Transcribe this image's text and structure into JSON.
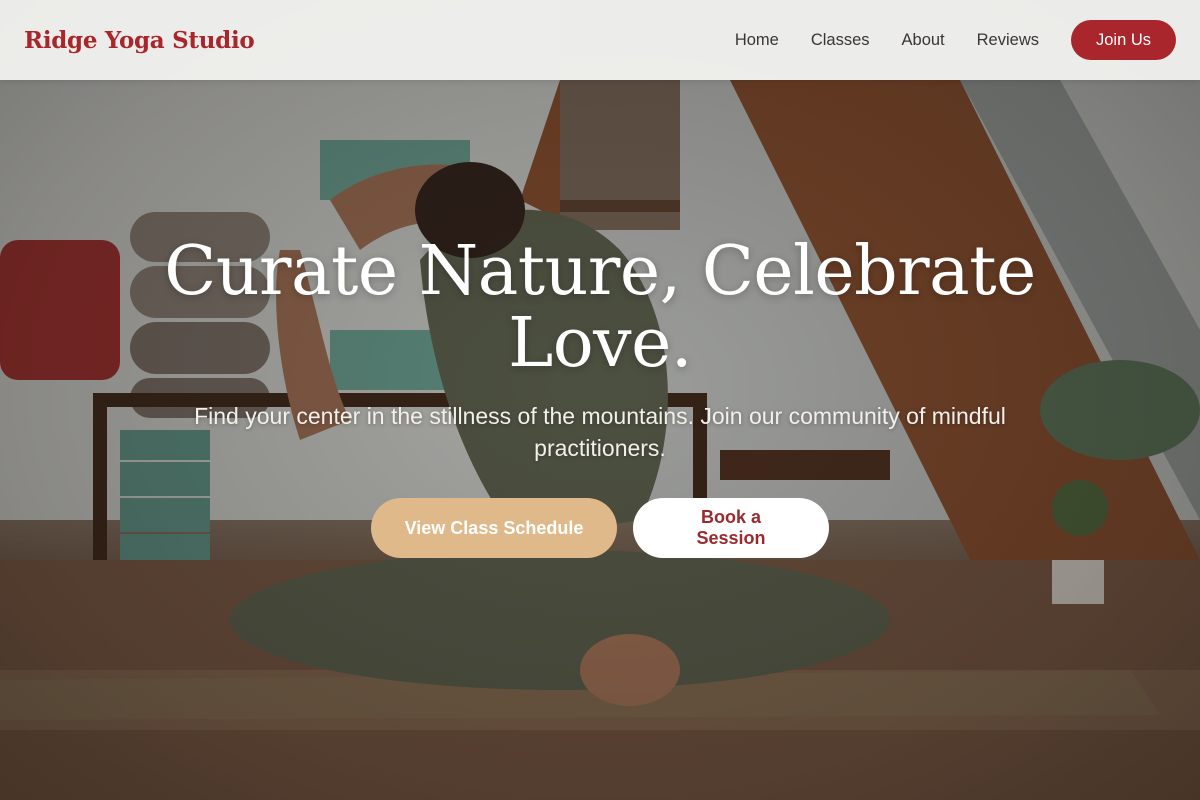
{
  "header": {
    "brand": "Ridge Yoga Studio",
    "nav": [
      {
        "label": "Home"
      },
      {
        "label": "Classes"
      },
      {
        "label": "About"
      },
      {
        "label": "Reviews"
      }
    ],
    "join_label": "Join Us"
  },
  "hero": {
    "headline": "Curate Nature, Celebrate Love.",
    "subtitle": "Find your center in the stillness of the mountains. Join our community of mindful practitioners.",
    "primary_cta": "View Class Schedule",
    "secondary_cta": "Book a Session"
  },
  "colors": {
    "brand": "#a8262c",
    "accent": "#dfb98a",
    "navbar_bg": "#f4f4f2"
  },
  "icons": {
    "hero_image": "yoga-pose-photo"
  }
}
